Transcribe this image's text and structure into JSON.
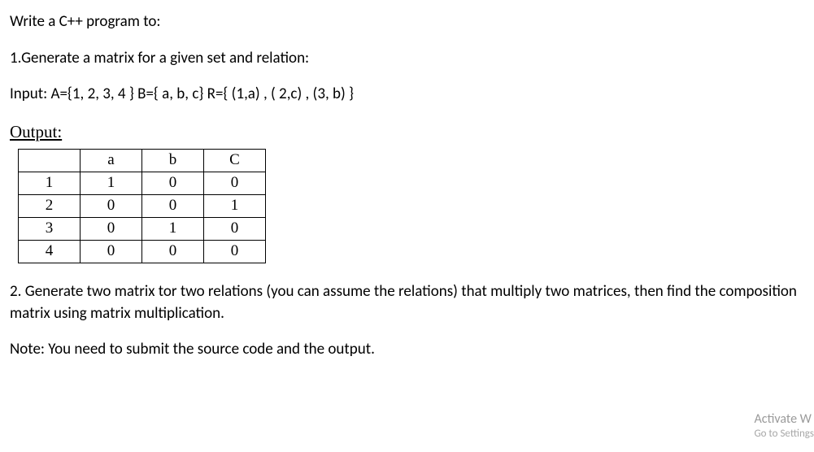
{
  "lines": {
    "l1": "Write a C++ program to:",
    "l2": "1.Generate a matrix for a given set and relation:",
    "l3": "Input: A={1, 2, 3, 4 } B={ a, b, c} R={ (1,a) , ( 2,c) , (3, b) }",
    "output_label": "Output:",
    "l4": "2. Generate two matrix tor two relations (you can assume the relations) that multiply two matrices, then find the composition matrix using matrix multiplication.",
    "l5": "Note: You need to submit the source code and the output."
  },
  "table": {
    "headers": [
      "",
      "a",
      "b",
      "C"
    ],
    "rows": [
      [
        "1",
        "1",
        "0",
        "0"
      ],
      [
        "2",
        "0",
        "0",
        "1"
      ],
      [
        "3",
        "0",
        "1",
        "0"
      ],
      [
        "4",
        "0",
        "0",
        "0"
      ]
    ]
  },
  "watermark": {
    "title": "Activate W",
    "subtitle": "Go to Settings"
  }
}
